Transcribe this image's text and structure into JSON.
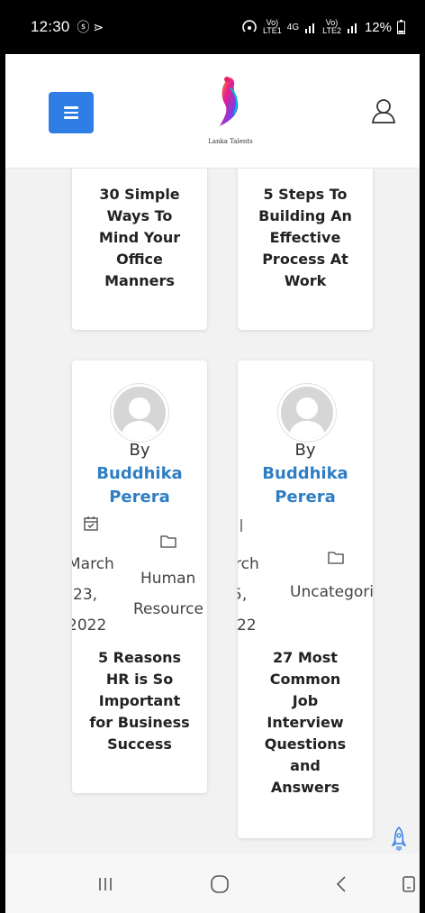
{
  "status_bar": {
    "time": "12:30",
    "left_icons": "ⓢ ⋗",
    "net1_top": "Vo)",
    "net1_bottom": "LTE1",
    "net_4g": "4G",
    "net2_top": "Vo)",
    "net2_bottom": "LTE2",
    "battery": "12%"
  },
  "header": {
    "logo_text": "Lanka Talents"
  },
  "posts": [
    {
      "title_lines": [
        "30 Simple",
        "Ways To",
        "Mind Your",
        "Office",
        "Manners"
      ]
    },
    {
      "title_lines": [
        "5 Steps To",
        "Building An",
        "Effective",
        "Process At",
        "Work"
      ]
    },
    {
      "by": "By",
      "author_lines": [
        "Buddhika",
        "Perera"
      ],
      "date_lines": [
        "March",
        "23,",
        "2022"
      ],
      "category_lines": [
        "Human",
        "Resource"
      ],
      "title_lines": [
        "5 Reasons",
        "HR is So",
        "Important",
        "for Business",
        "Success"
      ]
    },
    {
      "by": "By",
      "author_lines": [
        "Buddhika",
        "Perera"
      ],
      "date_lines": [
        "rch",
        "5,",
        "22"
      ],
      "category_lines": [
        "Uncategori"
      ],
      "title_lines": [
        "27 Most",
        "Common",
        "Job",
        "Interview",
        "Questions",
        "and",
        "Answers"
      ]
    }
  ],
  "icons": {
    "menu": "hamburger-icon",
    "user": "user-icon",
    "calendar": "calendar-icon",
    "folder": "folder-icon",
    "rocket": "rocket-icon"
  },
  "colors": {
    "accent": "#2f7ee6",
    "author": "#2f7ec4"
  }
}
